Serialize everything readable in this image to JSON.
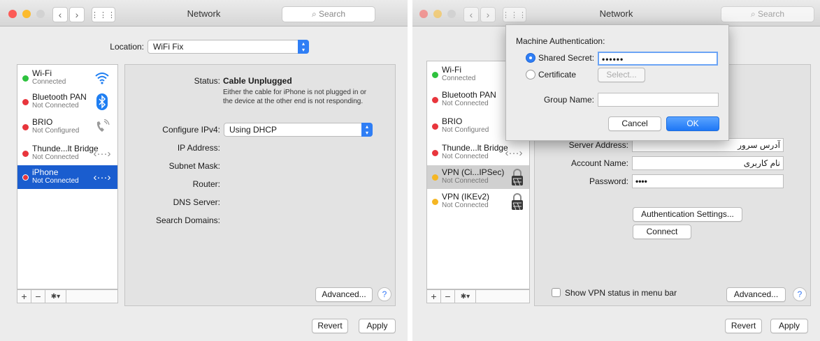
{
  "left_window": {
    "title": "Network",
    "search_placeholder": "Search",
    "location_label": "Location:",
    "location_value": "WiFi Fix",
    "services": [
      {
        "name": "Wi-Fi",
        "status": "Connected",
        "dot_color": "#2ec23e",
        "icon": "wifi-icon"
      },
      {
        "name": "Bluetooth PAN",
        "status": "Not Connected",
        "dot_color": "#e8353c",
        "icon": "bluetooth-icon"
      },
      {
        "name": "BRIO",
        "status": "Not Configured",
        "dot_color": "#e8353c",
        "icon": "phone-icon"
      },
      {
        "name": "Thunde...lt Bridge",
        "status": "Not Connected",
        "dot_color": "#e8353c",
        "icon": "bridge-icon"
      },
      {
        "name": "iPhone",
        "status": "Not Connected",
        "dot_color": "#e8353c",
        "icon": "bridge-icon",
        "selected": true
      }
    ],
    "status_label": "Status:",
    "status_value": "Cable Unplugged",
    "status_detail_line1": "Either the cable for iPhone is not plugged in or",
    "status_detail_line2": "the device at the other end is not responding.",
    "configure_label": "Configure IPv4:",
    "configure_value": "Using DHCP",
    "ip_label": "IP Address:",
    "subnet_label": "Subnet Mask:",
    "router_label": "Router:",
    "dns_label": "DNS Server:",
    "search_domains_label": "Search Domains:",
    "advanced_button": "Advanced...",
    "help_button": "?",
    "revert_button": "Revert",
    "apply_button": "Apply",
    "add_symbol": "+",
    "remove_symbol": "−",
    "gear_symbol": "✱▾"
  },
  "right_window": {
    "title": "Network",
    "search_placeholder": "Search",
    "services": [
      {
        "name": "Wi-Fi",
        "status": "Connected",
        "dot_color": "#2ec23e"
      },
      {
        "name": "Bluetooth PAN",
        "status": "Not Connected",
        "dot_color": "#e8353c"
      },
      {
        "name": "BRIO",
        "status": "Not Configured",
        "dot_color": "#e8353c"
      },
      {
        "name": "Thunde...lt Bridge",
        "status": "Not Connected",
        "dot_color": "#e8353c",
        "icon": "bridge-icon"
      },
      {
        "name": "VPN (Ci...IPSec)",
        "status": "Not Connected",
        "dot_color": "#f5b623",
        "icon": "lock-icon",
        "selected": true
      },
      {
        "name": "VPN (IKEv2)",
        "status": "Not Connected",
        "dot_color": "#f5b623",
        "icon": "lock-icon"
      }
    ],
    "server_address_label": "Server Address:",
    "server_address_value": "آدرس سرور",
    "account_name_label": "Account Name:",
    "account_name_value": "نام کاربری",
    "password_label": "Password:",
    "password_value": "••••",
    "auth_settings_button": "Authentication Settings...",
    "connect_button": "Connect",
    "show_vpn_label": "Show VPN status in menu bar",
    "advanced_button": "Advanced...",
    "help_button": "?",
    "revert_button": "Revert",
    "apply_button": "Apply",
    "add_symbol": "+",
    "remove_symbol": "−",
    "gear_symbol": "✱▾",
    "sheet": {
      "heading": "Machine Authentication:",
      "shared_secret_label": "Shared Secret:",
      "shared_secret_value": "••••••",
      "certificate_label": "Certificate",
      "select_button": "Select...",
      "group_name_label": "Group Name:",
      "group_name_value": "",
      "cancel_button": "Cancel",
      "ok_button": "OK"
    }
  }
}
